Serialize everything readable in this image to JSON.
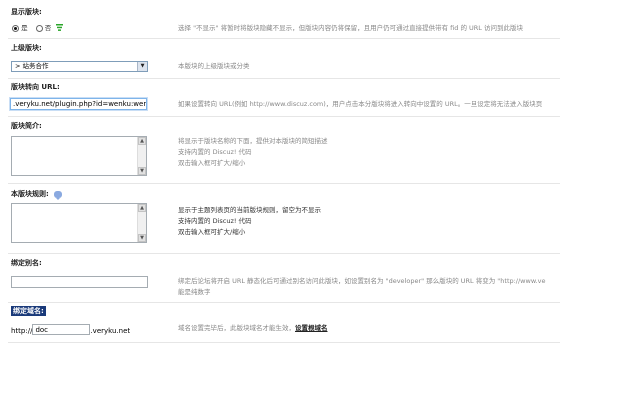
{
  "show_section": {
    "label": "显示版块:",
    "option_yes": "是",
    "option_no": "否",
    "hint": "选择 \"不显示\" 将暂时将版块隐藏不显示，但版块内容仍将保留，且用户仍可通过直接提供带有 fid 的 URL 访问到此版块"
  },
  "parent_section": {
    "label": "上级版块:",
    "selected": "> 站务合作",
    "hint": "本版块的上级版块或分类"
  },
  "redirect_url": {
    "label": "版块转向 URL:",
    "value": ".veryku.net/plugin.php?id=wenku:wenk",
    "hint": "如果设置转向 URL(例如 http://www.discuz.com)，用户点击本分版块将进入转向中设置的 URL。一旦设定将无法进入版块页"
  },
  "intro": {
    "label": "版块简介:",
    "hint_lines": [
      "将显示于版块名称的下面，提供对本版块的简短描述",
      "支持内置的 Discuz! 代码",
      "双击输入框可扩大/缩小"
    ]
  },
  "rules": {
    "label": "本版块规则:",
    "hint_lines": [
      "显示于主题列表页的当前版块规则，留空为不显示",
      "支持内置的 Discuz! 代码",
      "双击输入框可扩大/缩小"
    ]
  },
  "alias": {
    "label": "绑定别名:",
    "value": "",
    "hint_lines": [
      "绑定后论坛将开启 URL 静态化后可通过别名访问此版块，如设置别名为 \"developer\" 那么版块的 URL 将变为 \"http://www.ve",
      "能是纯数字"
    ]
  },
  "domain": {
    "label": "绑定域名:",
    "prefix": "http://",
    "value": "doc",
    "suffix": ".veryku.net",
    "hint": "域名设置完毕后，此版块域名才能生效，",
    "link": "设置根域名"
  },
  "colors": {
    "accent_label_bg": "#1a3a7a",
    "icon_green": "#2aa52a",
    "help_blue": "#8aa9e0"
  }
}
